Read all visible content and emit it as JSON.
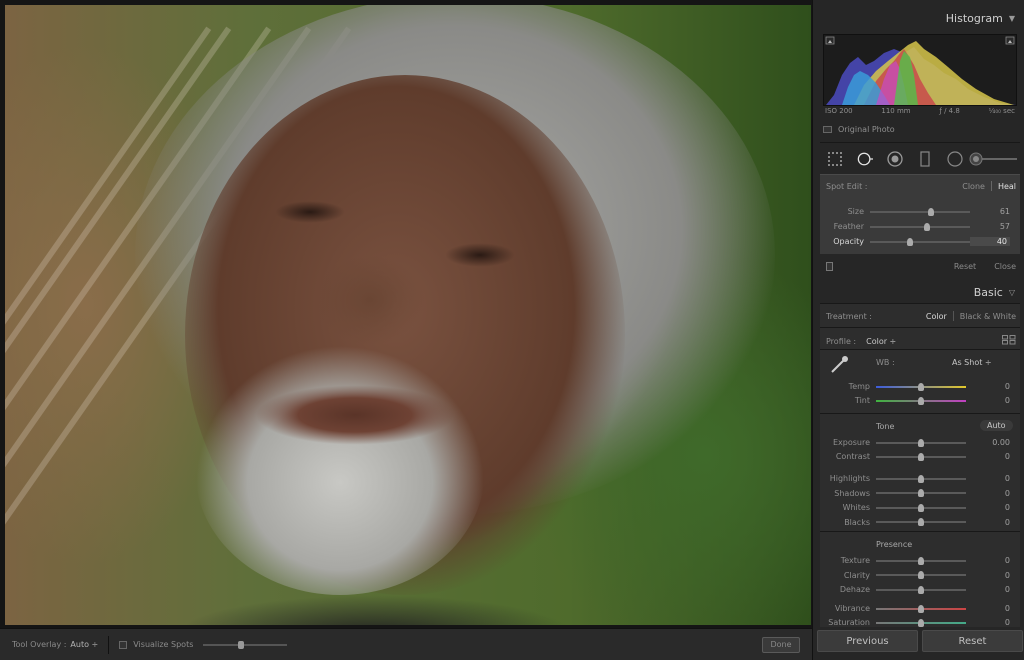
{
  "toolbar": {
    "tool_overlay_label": "Tool Overlay :",
    "tool_overlay_value": "Auto ÷",
    "visualize_spots_label": "Visualize Spots",
    "visualize_spots_checked": false,
    "visualize_spots_level": 0.45,
    "done_label": "Done"
  },
  "histogram": {
    "title": "Histogram",
    "iso": "ISO 200",
    "focal_length": "110 mm",
    "aperture": "ƒ / 4.8",
    "shutter": "⅟₄₀₀ sec",
    "original_photo_label": "Original Photo"
  },
  "spot_edit": {
    "label": "Spot Edit :",
    "clone_label": "Clone",
    "heal_label": "Heal",
    "sliders": [
      {
        "label": "Size",
        "value": "61",
        "level": 0.61
      },
      {
        "label": "Feather",
        "value": "57",
        "level": 0.57
      },
      {
        "label": "Opacity",
        "value": "40",
        "level": 0.4
      }
    ],
    "reset_label": "Reset",
    "close_label": "Close"
  },
  "basic": {
    "title": "Basic",
    "treatment_label": "Treatment :",
    "color_label": "Color",
    "bw_label": "Black & White",
    "profile_label": "Profile :",
    "profile_value": "Color ÷",
    "wb_label": "WB :",
    "wb_value": "As Shot ÷",
    "tone_label": "Tone",
    "auto_label": "Auto",
    "presence_label": "Presence",
    "wb_sliders": [
      {
        "label": "Temp",
        "value": "0"
      },
      {
        "label": "Tint",
        "value": "0"
      }
    ],
    "tone_sliders_a": [
      {
        "label": "Exposure",
        "value": "0.00"
      },
      {
        "label": "Contrast",
        "value": "0"
      }
    ],
    "tone_sliders_b": [
      {
        "label": "Highlights",
        "value": "0"
      },
      {
        "label": "Shadows",
        "value": "0"
      },
      {
        "label": "Whites",
        "value": "0"
      },
      {
        "label": "Blacks",
        "value": "0"
      }
    ],
    "presence_sliders_a": [
      {
        "label": "Texture",
        "value": "0"
      },
      {
        "label": "Clarity",
        "value": "0"
      },
      {
        "label": "Dehaze",
        "value": "0"
      }
    ],
    "presence_sliders_b": [
      {
        "label": "Vibrance",
        "value": "0"
      },
      {
        "label": "Saturation",
        "value": "0"
      }
    ]
  },
  "buttons": {
    "previous_label": "Previous",
    "reset_label": "Reset"
  },
  "colors": {
    "panel_bg": "#262626",
    "spot_bg": "#3a3a3a",
    "heal_active": "#e0e0e0",
    "temp_gradient": [
      "#3b5bdc",
      "#e2c82a"
    ],
    "tint_gradient": [
      "#3fb33f",
      "#c23fc2"
    ]
  }
}
